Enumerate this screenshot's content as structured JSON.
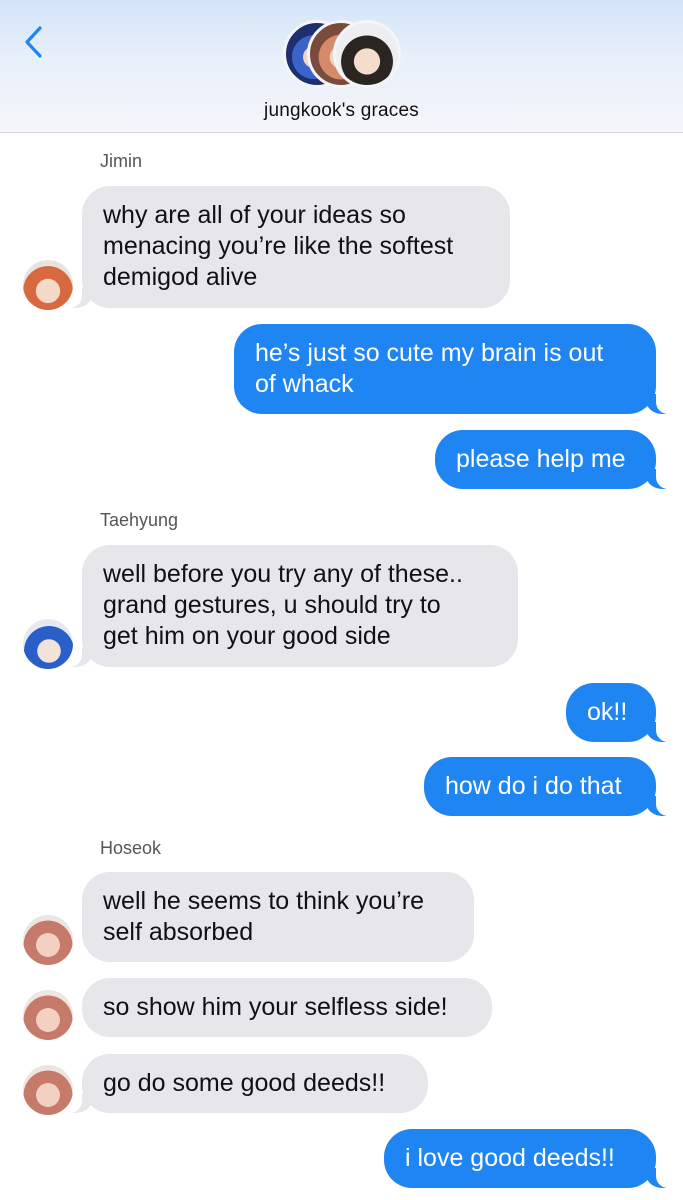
{
  "header": {
    "back_icon": "chevron-left-icon",
    "group_name": "jungkook's graces",
    "accent_color": "#1f85f3"
  },
  "messages": [
    {
      "from": "Jimin",
      "direction": "in",
      "text_lines": [
        "why are all of your ideas so",
        "menacing you’re like the softest",
        "demigod alive"
      ]
    },
    {
      "from": "me",
      "direction": "out",
      "text_lines": [
        "he’s just so cute my brain is out",
        "of whack"
      ]
    },
    {
      "from": "me",
      "direction": "out",
      "text_lines": [
        "please help me"
      ]
    },
    {
      "from": "Taehyung",
      "direction": "in",
      "text_lines": [
        "well before you try any of these..",
        "grand gestures, u should try to",
        "get him on your good side"
      ]
    },
    {
      "from": "me",
      "direction": "out",
      "text_lines": [
        "ok!!"
      ]
    },
    {
      "from": "me",
      "direction": "out",
      "text_lines": [
        "how do i do that"
      ]
    },
    {
      "from": "Hoseok",
      "direction": "in",
      "text_lines": [
        "well he seems to think you’re",
        "self absorbed"
      ]
    },
    {
      "from": "Hoseok",
      "direction": "in",
      "text_lines": [
        "so show him your selfless side!"
      ]
    },
    {
      "from": "Hoseok",
      "direction": "in",
      "text_lines": [
        "go do some good deeds!!"
      ]
    },
    {
      "from": "me",
      "direction": "out",
      "text_lines": [
        "i love good deeds!!"
      ]
    }
  ],
  "senders": {
    "jimin": "Jimin",
    "taehyung": "Taehyung",
    "hoseok": "Hoseok"
  }
}
